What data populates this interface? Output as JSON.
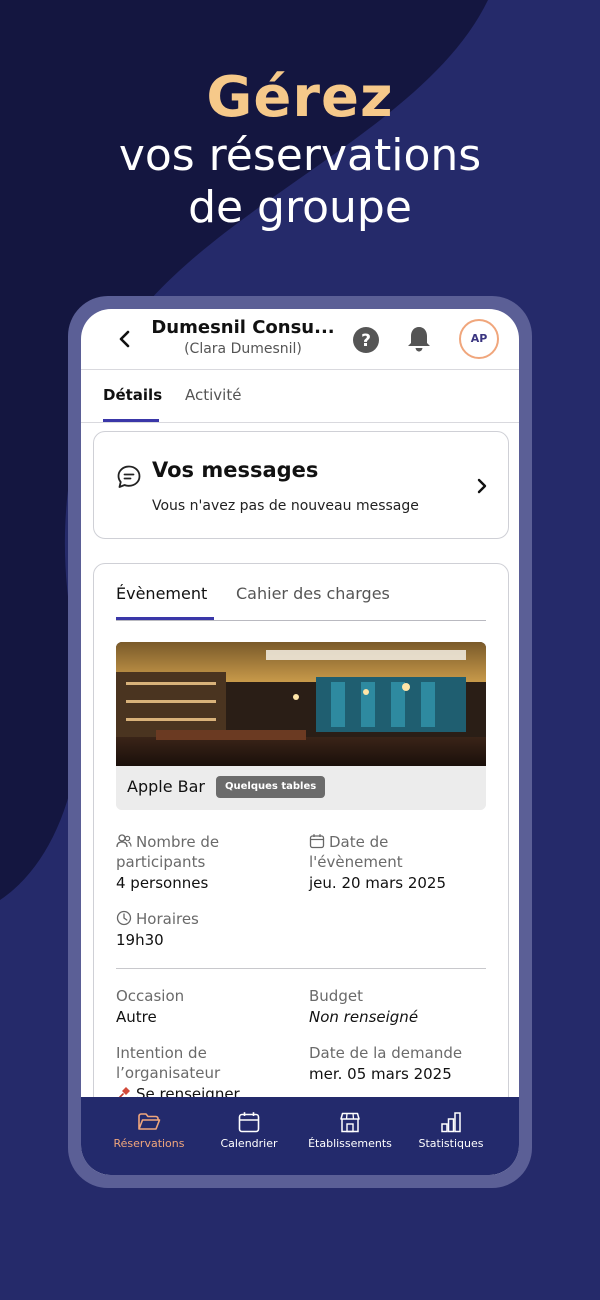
{
  "hero": {
    "accent": "Gérez",
    "line1": "vos réservations",
    "line2": "de groupe"
  },
  "colors": {
    "background": "#252a6a",
    "accent": "#f6c98a",
    "primary": "#3a37a8",
    "active_nav": "#f0a67c"
  },
  "header": {
    "title": "Dumesnil Consu...",
    "subtitle": "(Clara Dumesnil)",
    "avatar_initials": "AP",
    "icons": [
      "back-icon",
      "help-icon",
      "bell-icon"
    ]
  },
  "tabs": [
    {
      "label": "Détails",
      "active": true
    },
    {
      "label": "Activité",
      "active": false
    }
  ],
  "messages": {
    "title": "Vos messages",
    "subtitle": "Vous n'avez pas de nouveau message"
  },
  "event_tabs": [
    {
      "label": "Évènement",
      "active": true
    },
    {
      "label": "Cahier des charges",
      "active": false
    }
  ],
  "venue": {
    "name": "Apple Bar",
    "badge": "Quelques tables"
  },
  "details": {
    "participants_label_1": "Nombre de",
    "participants_label_2": "participants",
    "participants_value": "4 personnes",
    "date_label_1": "Date de",
    "date_label_2": "l'évènement",
    "date_value": "jeu. 20 mars 2025",
    "hours_label": "Horaires",
    "hours_value": "19h30",
    "occasion_label": "Occasion",
    "occasion_value": "Autre",
    "budget_label": "Budget",
    "budget_value": "Non renseigné",
    "intention_label_1": "Intention de",
    "intention_label_2": "l’organisateur",
    "intention_value": "Se renseigner",
    "request_date_label": "Date de la demande",
    "request_date_value": "mer. 05 mars 2025"
  },
  "bottom_nav": [
    {
      "label": "Réservations",
      "active": true
    },
    {
      "label": "Calendrier",
      "active": false
    },
    {
      "label": "Établissements",
      "active": false
    },
    {
      "label": "Statistiques",
      "active": false
    }
  ]
}
